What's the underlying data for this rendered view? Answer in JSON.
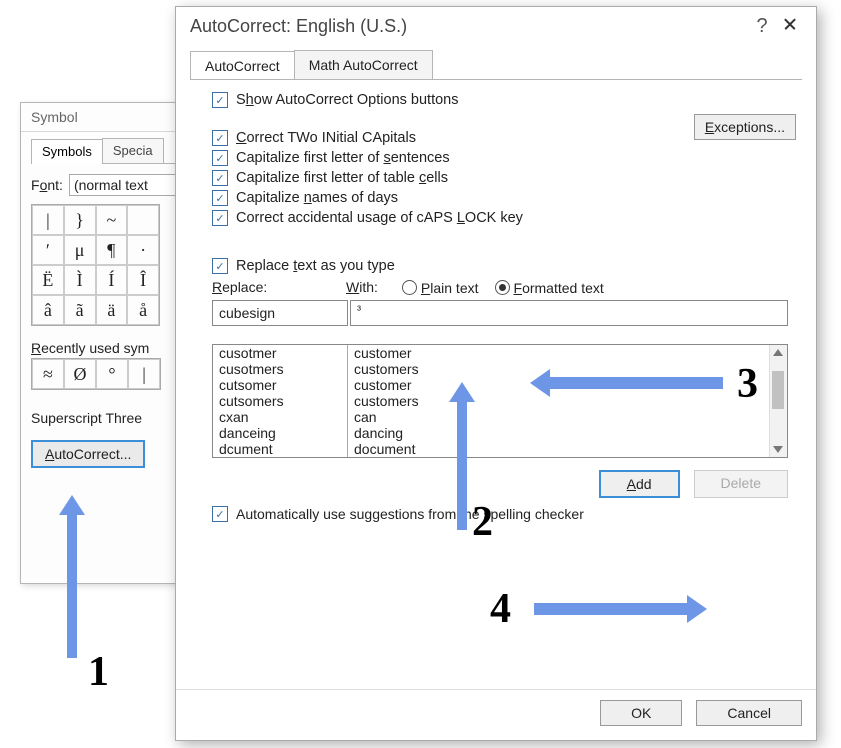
{
  "symbol_dialog": {
    "title": "Symbol",
    "tabs": [
      "Symbols",
      "Specia"
    ],
    "font_label_pre": "F",
    "font_label_u": "o",
    "font_label_post": "nt:",
    "font_value": "(normal text",
    "grid": [
      [
        "|",
        "}",
        "~",
        "",
        ""
      ],
      [
        "ʹ",
        "μ",
        "¶",
        "·"
      ],
      [
        "Ё",
        "Ì",
        "Í",
        "Î"
      ],
      [
        "â",
        "ã",
        "ä",
        "å"
      ]
    ],
    "recent_label_pre": "",
    "recent_label_u": "R",
    "recent_label_post": "ecently used sym",
    "recent": [
      "≈",
      "Ø",
      "°",
      "|"
    ],
    "superscript_label": "Superscript Three",
    "autocorrect_btn_pre": "",
    "autocorrect_btn_u": "A",
    "autocorrect_btn_post": "utoCorrect..."
  },
  "ac_dialog": {
    "title": "AutoCorrect: English (U.S.)",
    "help": "?",
    "tabs": {
      "tab1": "AutoCorrect",
      "tab2": "Math AutoCorrect"
    },
    "show_options_pre": "S",
    "show_options_u": "h",
    "show_options_post": "ow AutoCorrect Options buttons",
    "two_initial_pre": "",
    "two_initial_u": "C",
    "two_initial_post": "orrect TWo INitial CApitals",
    "cap_sentences": "Capitalize first letter of ",
    "cap_sentences_u": "s",
    "cap_sentences_post": "entences",
    "cap_table": "Capitalize first letter of table ",
    "cap_table_u": "c",
    "cap_table_post": "ells",
    "cap_days": "Capitalize ",
    "cap_days_u": "n",
    "cap_days_post": "ames of days",
    "caps_lock": "Correct accidental usage of cAPS ",
    "caps_lock_u": "L",
    "caps_lock_post": "OCK key",
    "exceptions_pre": "",
    "exceptions_u": "E",
    "exceptions_post": "xceptions...",
    "replace_type_pre": "Replace ",
    "replace_type_u": "t",
    "replace_type_post": "ext as you type",
    "replace_label_pre": "",
    "replace_label_u": "R",
    "replace_label_post": "eplace:",
    "with_label_pre": "",
    "with_label_u": "W",
    "with_label_post": "ith:",
    "plain_pre": "",
    "plain_u": "P",
    "plain_post": "lain text",
    "formatted_pre": "",
    "formatted_u": "F",
    "formatted_post": "ormatted text",
    "replace_value": "cubesign",
    "with_value": "³",
    "list": [
      {
        "a": "cusotmer",
        "b": "customer"
      },
      {
        "a": "cusotmers",
        "b": "customers"
      },
      {
        "a": "cutsomer",
        "b": "customer"
      },
      {
        "a": "cutsomers",
        "b": "customers"
      },
      {
        "a": "cxan",
        "b": "can"
      },
      {
        "a": "danceing",
        "b": "dancing"
      },
      {
        "a": "dcument",
        "b": "document"
      }
    ],
    "add_u": "A",
    "add_post": "dd",
    "delete_label": "Delete",
    "auto_suggest": "Automatically use su",
    "auto_suggest_u": "g",
    "auto_suggest_post": "gestions from the spelling checker",
    "ok": "OK",
    "cancel": "Cancel"
  },
  "annotations": {
    "n1": "1",
    "n2": "2",
    "n3": "3",
    "n4": "4"
  }
}
